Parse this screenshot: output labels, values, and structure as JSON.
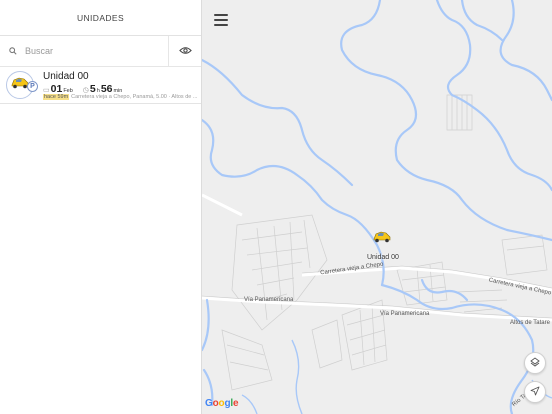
{
  "sidebar": {
    "title": "UNIDADES",
    "search": {
      "placeholder": "Buscar",
      "value": ""
    },
    "units": [
      {
        "name": "Unidad 00",
        "badge": "P",
        "date_day": "01",
        "date_month": "Feb",
        "duration_h": "5",
        "duration_h_unit": "h",
        "duration_m": "56",
        "duration_m_unit": "min",
        "time_ago": "hace 59m",
        "address": "Carretera vieja a Chepo, Panamá, 5.00 · Altos de ..."
      }
    ]
  },
  "map": {
    "unit_label": "Unidad 00",
    "labels": {
      "carretera_1": "Carretera vieja a Chepo",
      "carretera_2": "Carretera vieja a Chepo",
      "via_pan_1": "Vía Panamericana",
      "via_pan_2": "Vía Panamericana",
      "altos": "Altos de Tatare",
      "rio": "Río Tataré"
    },
    "attribution": [
      "G",
      "o",
      "o",
      "g",
      "l",
      "e"
    ]
  },
  "colors": {
    "river": "#a8c8f8",
    "road": "#ffffff",
    "background": "#eeeeee",
    "car": "#f5c518"
  },
  "icons": [
    "search-icon",
    "eye-icon",
    "car-icon",
    "menu-icon",
    "layers-icon",
    "navigate-icon"
  ]
}
